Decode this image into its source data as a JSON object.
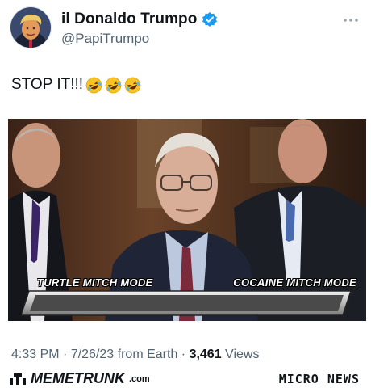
{
  "author": {
    "display_name": "il Donaldo Trumpo",
    "handle": "@PapiTrumpo"
  },
  "tweet": {
    "text": "STOP IT!!!",
    "emojis": [
      "rolling-on-floor-laughing-icon",
      "rolling-on-floor-laughing-icon",
      "rolling-on-floor-laughing-icon"
    ]
  },
  "media": {
    "caption_left": "TURTLE MITCH MODE",
    "caption_right": "COCAINE MITCH MODE"
  },
  "meta": {
    "time": "4:33 PM",
    "sep1": " · ",
    "date": "7/26/23",
    "source": " from Earth",
    "sep2": " · ",
    "views_count": "3,461",
    "views_label": " Views"
  },
  "footer": {
    "brand": "MEMETRUNK",
    "brand_suffix": ".com",
    "right": "MICRO NEWS"
  },
  "colors": {
    "verified": "#1d9bf0",
    "muted": "#536471"
  }
}
